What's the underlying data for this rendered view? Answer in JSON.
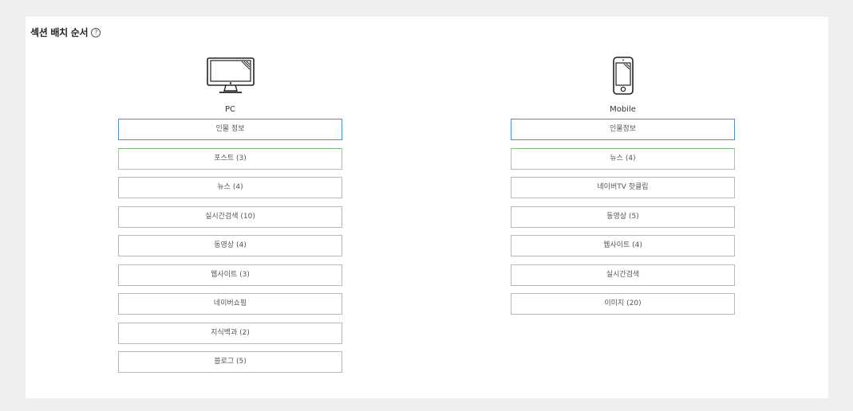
{
  "section": {
    "title": "섹션 배치 순서",
    "help_glyph": "?"
  },
  "pc": {
    "label": "PC",
    "icon": "desktop-monitor-icon",
    "items": [
      {
        "label": "인물 정보",
        "selected": true
      },
      {
        "label": "포스트 (3)"
      },
      {
        "label": "뉴스 (4)"
      },
      {
        "label": "실시간검색 (10)"
      },
      {
        "label": "동영상 (4)"
      },
      {
        "label": "웹사이트 (3)"
      },
      {
        "label": "네이버쇼핑"
      },
      {
        "label": "지식백과 (2)"
      },
      {
        "label": "블로그 (5)"
      }
    ]
  },
  "mobile": {
    "label": "Mobile",
    "icon": "smartphone-icon",
    "items": [
      {
        "label": "인물정보",
        "selected": true
      },
      {
        "label": "뉴스 (4)"
      },
      {
        "label": "네이버TV 핫클립"
      },
      {
        "label": "동영상 (5)"
      },
      {
        "label": "웹사이트 (4)"
      },
      {
        "label": "실시간검색"
      },
      {
        "label": "이미지 (20)"
      }
    ]
  },
  "colors": {
    "selected_border": "#4a8fd9",
    "item_border": "#b7b7b7",
    "background": "#efefef"
  }
}
